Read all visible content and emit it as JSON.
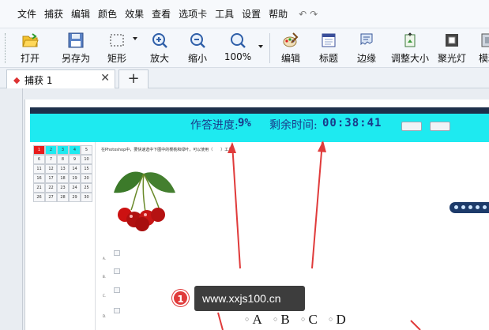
{
  "menu": {
    "items": [
      "文件",
      "捕获",
      "编辑",
      "颜色",
      "效果",
      "查看",
      "选项卡",
      "工具",
      "设置",
      "帮助"
    ],
    "undo_glyph": "↶",
    "redo_glyph": "↷"
  },
  "toolbar": {
    "open": "打开",
    "save_as": "另存为",
    "rect": "矩形",
    "zoom_in": "放大",
    "zoom_out": "缩小",
    "zoom_level": "100%",
    "edit": "编辑",
    "title": "标题",
    "edge": "边缘",
    "resize": "调整大小",
    "spotlight": "聚光灯",
    "blur": "模糊"
  },
  "tabs": {
    "active_label": "捕获 1",
    "close": "✕",
    "new": "+"
  },
  "exam": {
    "progress_label": "作答进度:",
    "progress_value": "9%",
    "remain_label": "剩余时间:",
    "remain_value": "00:38:41",
    "question_text": "在Photoshop中，要快速选中下图中的樱桃和绿叶，可以使用（　　）工具。",
    "grid_numbers": [
      "1",
      "2",
      "3",
      "4",
      "5",
      "6",
      "7",
      "8",
      "9",
      "10",
      "11",
      "12",
      "13",
      "14",
      "15",
      "16",
      "17",
      "18",
      "19",
      "20",
      "21",
      "22",
      "23",
      "24",
      "25",
      "26",
      "27",
      "28",
      "29",
      "30"
    ],
    "option_letters": [
      "A.",
      "B.",
      "C.",
      "D."
    ],
    "answer_options": [
      "A",
      "B",
      "C",
      "D"
    ]
  },
  "overlay": {
    "badge_number": "1",
    "url": "www.xxjs100.cn"
  },
  "colors": {
    "accent_cyan": "#1eeaf0",
    "header_dark": "#1d2f4a",
    "annotation_red": "#e03b3b"
  }
}
